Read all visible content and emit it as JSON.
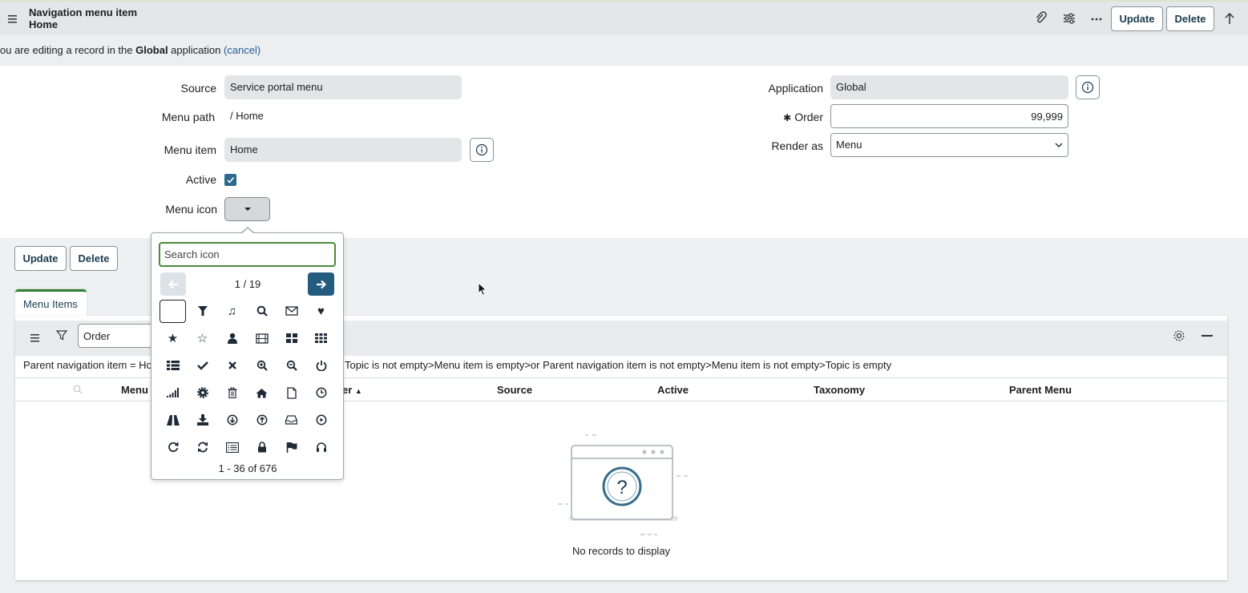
{
  "header": {
    "title_line1": "Navigation menu item",
    "title_line2": "Home",
    "update_label": "Update",
    "delete_label": "Delete"
  },
  "edit_message": {
    "prefix": "ou are editing a record in the ",
    "app_name": "Global",
    "suffix": " application ",
    "cancel": "(cancel)"
  },
  "form": {
    "source_label": "Source",
    "source_value": "Service portal menu",
    "menu_path_label": "Menu path",
    "menu_path_value": "/ Home",
    "menu_item_label": "Menu item",
    "menu_item_value": "Home",
    "active_label": "Active",
    "active_checked": true,
    "menu_icon_label": "Menu icon",
    "application_label": "Application",
    "application_value": "Global",
    "order_required": "✱",
    "order_label": "Order",
    "order_value": "99,999",
    "render_as_label": "Render as",
    "render_as_value": "Menu"
  },
  "actions": {
    "update_label": "Update",
    "delete_label": "Delete"
  },
  "icon_picker": {
    "search_placeholder": "Search icon",
    "page_indicator": "1 / 19",
    "range_text": "1 - 36 of 676",
    "icons": [
      "blank",
      "filter-glass",
      "music",
      "search",
      "envelope",
      "heart",
      "star",
      "star-empty",
      "user",
      "film",
      "th-large",
      "th",
      "th-list",
      "ok",
      "remove",
      "zoom-in",
      "zoom-out",
      "off",
      "signal",
      "cog",
      "trash",
      "home",
      "file",
      "time",
      "road",
      "download-alt",
      "download",
      "upload",
      "inbox",
      "play-circle",
      "repeat",
      "refresh",
      "list-alt",
      "lock",
      "flag",
      "headphones"
    ]
  },
  "related_list": {
    "tab_label": "Menu Items",
    "search_field_value": "Order",
    "breadcrumb_prefix": "Parent navigation item = Ho",
    "breadcrumb_rest": "Topic is not empty>Menu item is empty>or Parent navigation item is not empty>Menu item is not empty>Topic is empty",
    "columns": [
      "Menu",
      "er",
      "Source",
      "Active",
      "Taxonomy",
      "Parent Menu"
    ],
    "empty_text": "No records to display"
  }
}
